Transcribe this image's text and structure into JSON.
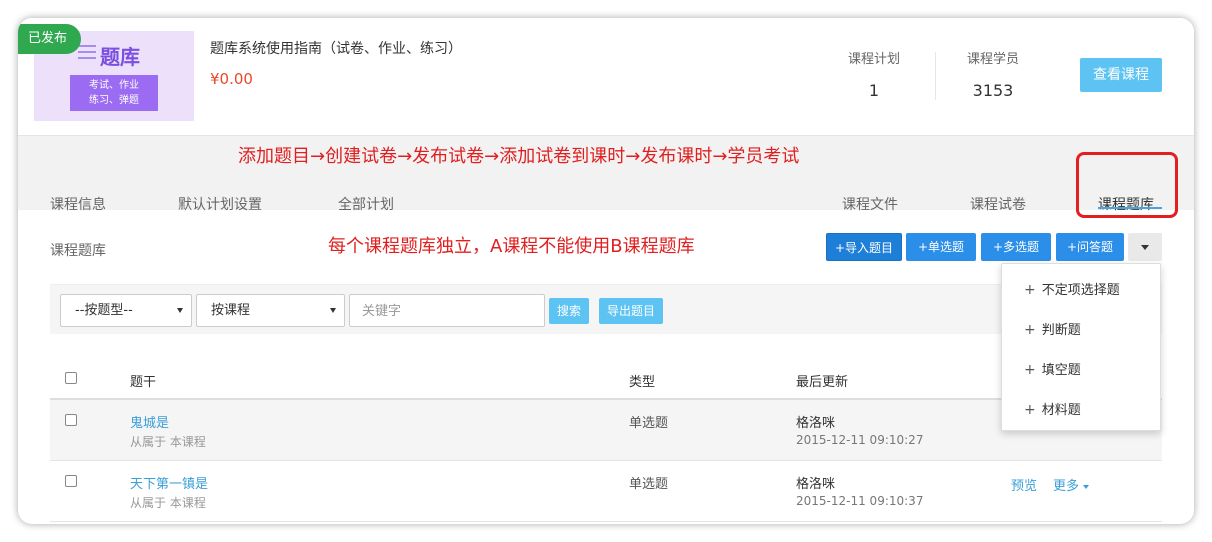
{
  "header": {
    "status_badge": "已发布",
    "thumb_title": "题库",
    "thumb_line1": "考试、作业",
    "thumb_line2": "练习、弹题",
    "course_title": "题库系统使用指南（试卷、作业、练习）",
    "price": "¥0.00",
    "stats": {
      "plan_label": "课程计划",
      "plan_value": "1",
      "student_label": "课程学员",
      "student_value": "3153"
    },
    "view_button": "查看课程"
  },
  "annotations": {
    "flow": "添加题目→创建试卷→发布试卷→添加试卷到课时→发布课时→学员考试",
    "note": "每个课程题库独立，A课程不能使用B课程题库"
  },
  "tabs": [
    "课程信息",
    "默认计划设置",
    "全部计划",
    "课程文件",
    "课程试卷",
    "课程题库"
  ],
  "section": {
    "title": "课程题库",
    "toolbar": {
      "import": "导入题目",
      "single": "单选题",
      "multi": "多选题",
      "essay": "问答题"
    }
  },
  "dropdown": {
    "items": [
      "不定项选择题",
      "判断题",
      "填空题",
      "材料题"
    ]
  },
  "filter": {
    "type_select": "--按题型--",
    "scope_select": "按课程",
    "keyword_placeholder": "关键字",
    "search_button": "搜索",
    "export_button": "导出题目"
  },
  "table": {
    "headers": [
      "题干",
      "类型",
      "最后更新"
    ],
    "rows": [
      {
        "title": "鬼城是",
        "source": "从属于 本课程",
        "type": "单选题",
        "user": "格洛咪",
        "time": "2015-12-11 09:10:27"
      },
      {
        "title": "天下第一镇是",
        "source": "从属于 本课程",
        "type": "单选题",
        "user": "格洛咪",
        "time": "2015-12-11 09:10:37",
        "actions": {
          "preview": "预览",
          "more": "更多"
        }
      }
    ]
  },
  "colors": {
    "accent_blue": "#2b8ee8",
    "light_blue": "#5cc3f2",
    "annotation_red": "#e02020",
    "badge_green": "#2fa84f",
    "price_red": "#e8492b"
  }
}
